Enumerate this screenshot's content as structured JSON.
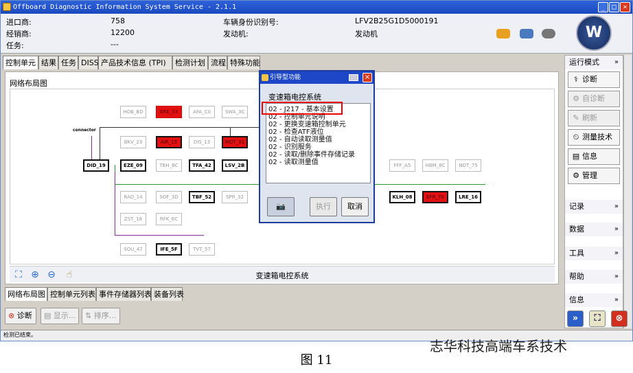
{
  "window": {
    "title": "Offboard Diagnostic Information System Service - 2.1.1"
  },
  "info": {
    "importer_label": "进口商:",
    "importer_value": "758",
    "dealer_label": "经销商:",
    "dealer_value": "12200",
    "task_label": "任务:",
    "task_value": "---",
    "vin_label": "车辆身份识别号:",
    "vin_value": "LFV2B25G1D5000191",
    "engine_label": "发动机:",
    "engine_value": "发动机"
  },
  "tabs": [
    "控制单元",
    "结果",
    "任务",
    "DISS",
    "产品技术信息 (TPI)",
    "检测计划",
    "流程",
    "特殊功能"
  ],
  "network": {
    "title": "网络布局图",
    "connector_label": "connector",
    "status_text": "变速箱电控系统",
    "nodes": [
      {
        "label": "HOB_BD",
        "state": "off"
      },
      {
        "label": "BRE_03",
        "state": "err"
      },
      {
        "label": "AFA_C0",
        "state": "off"
      },
      {
        "label": "SWA_3C",
        "state": "off"
      },
      {
        "label": "BKV_23",
        "state": "off"
      },
      {
        "label": "AIR_15",
        "state": "onerr"
      },
      {
        "label": "DIS_13",
        "state": "off"
      },
      {
        "label": "MOT_01",
        "state": "onerr"
      },
      {
        "label": "DID_19",
        "state": "on"
      },
      {
        "label": "EZE_09",
        "state": "on"
      },
      {
        "label": "TBH_BC",
        "state": "off"
      },
      {
        "label": "TFA_42",
        "state": "on"
      },
      {
        "label": "LSV_2B",
        "state": "on"
      },
      {
        "label": "FFF_A5",
        "state": "off"
      },
      {
        "label": "HBM_8C",
        "state": "off"
      },
      {
        "label": "NOT_75",
        "state": "off"
      },
      {
        "label": "RAD_14",
        "state": "off"
      },
      {
        "label": "SOF_3D",
        "state": "off"
      },
      {
        "label": "TBF_52",
        "state": "on"
      },
      {
        "label": "SPR_32",
        "state": "off"
      },
      {
        "label": "KLH_08",
        "state": "on"
      },
      {
        "label": "EFR_70",
        "state": "onerr"
      },
      {
        "label": "LRE_16",
        "state": "on"
      },
      {
        "label": "ZST_18",
        "state": "off"
      },
      {
        "label": "RFK_6C",
        "state": "off"
      },
      {
        "label": "SOU_47",
        "state": "off"
      },
      {
        "label": "IFE_5F",
        "state": "on"
      },
      {
        "label": "TVT_57",
        "state": "off"
      }
    ]
  },
  "bottom_tabs": [
    "网络布局图",
    "控制单元列表",
    "事件存储器列表",
    "装备列表"
  ],
  "bottom_buttons": {
    "diagnose": "诊断",
    "display": "显示...",
    "sort": "排序..."
  },
  "status_line": "检测已结束。",
  "right_panel": {
    "mode_header": "运行模式",
    "buttons": [
      {
        "label": "诊断",
        "enabled": true,
        "icon": "stethoscope-icon"
      },
      {
        "label": "自诊断",
        "enabled": false,
        "icon": "self-diagnosis-icon"
      },
      {
        "label": "刷新",
        "enabled": false,
        "icon": "flash-icon"
      },
      {
        "label": "测量技术",
        "enabled": true,
        "icon": "measure-icon"
      },
      {
        "label": "信息",
        "enabled": true,
        "icon": "info-book-icon"
      },
      {
        "label": "管理",
        "enabled": true,
        "icon": "admin-icon"
      }
    ],
    "sections": [
      "记录",
      "数据",
      "工具",
      "帮助",
      "信息"
    ]
  },
  "dialog": {
    "title": "引导型功能",
    "heading": "变速箱电控系统",
    "items": [
      "02 - J217 - 基本设置",
      "02 - 控制单元说明",
      "02 - 更换变速箱控制单元",
      "02 - 检查ATF液位",
      "02 - 自动读取测量值",
      "02 - 识别服务",
      "02 - 读取/删除事件存储记录",
      "02 - 读取测量值"
    ],
    "execute_label": "执行",
    "cancel_label": "取消"
  },
  "caption": "图 11",
  "watermark": "志华科技高端车系技术",
  "colors": {
    "title_bar": "#1a48bf",
    "error_node": "#e21010",
    "highlight_box": "#e00000"
  }
}
